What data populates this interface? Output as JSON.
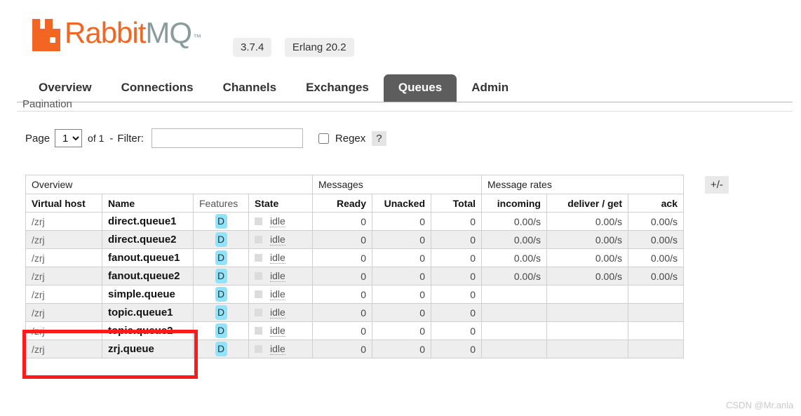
{
  "header": {
    "logo_rabbit": "Rabbit",
    "logo_mq": "MQ",
    "logo_tm": "™",
    "version": "3.7.4",
    "erlang_version": "Erlang 20.2"
  },
  "nav": {
    "tabs": [
      {
        "label": "Overview",
        "active": false
      },
      {
        "label": "Connections",
        "active": false
      },
      {
        "label": "Channels",
        "active": false
      },
      {
        "label": "Exchanges",
        "active": false
      },
      {
        "label": "Queues",
        "active": true
      },
      {
        "label": "Admin",
        "active": false
      }
    ]
  },
  "pagination": {
    "heading": "Pagination",
    "page_label": "Page",
    "page_value": "1",
    "page_options": [
      "1"
    ],
    "of_text": "of 1",
    "dash": "-",
    "filter_label": "Filter:",
    "filter_value": "",
    "filter_placeholder": "",
    "regex_label": "Regex",
    "regex_checked": false,
    "help_label": "?"
  },
  "table": {
    "toggle_label": "+/-",
    "group_headers": [
      {
        "label": "Overview",
        "span": 4
      },
      {
        "label": "Messages",
        "span": 3
      },
      {
        "label": "Message rates",
        "span": 3
      }
    ],
    "columns": [
      {
        "label": "Virtual host",
        "align": "left",
        "soft": false
      },
      {
        "label": "Name",
        "align": "left",
        "soft": false
      },
      {
        "label": "Features",
        "align": "left",
        "soft": true
      },
      {
        "label": "State",
        "align": "left",
        "soft": false
      },
      {
        "label": "Ready",
        "align": "right",
        "soft": false
      },
      {
        "label": "Unacked",
        "align": "right",
        "soft": false
      },
      {
        "label": "Total",
        "align": "right",
        "soft": false
      },
      {
        "label": "incoming",
        "align": "right",
        "soft": false
      },
      {
        "label": "deliver / get",
        "align": "right",
        "soft": false
      },
      {
        "label": "ack",
        "align": "right",
        "soft": false
      }
    ],
    "rows": [
      {
        "vhost": "/zrj",
        "name": "direct.queue1",
        "feature": "D",
        "state": "idle",
        "ready": "0",
        "unacked": "0",
        "total": "0",
        "incoming": "0.00/s",
        "deliver_get": "0.00/s",
        "ack": "0.00/s"
      },
      {
        "vhost": "/zrj",
        "name": "direct.queue2",
        "feature": "D",
        "state": "idle",
        "ready": "0",
        "unacked": "0",
        "total": "0",
        "incoming": "0.00/s",
        "deliver_get": "0.00/s",
        "ack": "0.00/s"
      },
      {
        "vhost": "/zrj",
        "name": "fanout.queue1",
        "feature": "D",
        "state": "idle",
        "ready": "0",
        "unacked": "0",
        "total": "0",
        "incoming": "0.00/s",
        "deliver_get": "0.00/s",
        "ack": "0.00/s"
      },
      {
        "vhost": "/zrj",
        "name": "fanout.queue2",
        "feature": "D",
        "state": "idle",
        "ready": "0",
        "unacked": "0",
        "total": "0",
        "incoming": "0.00/s",
        "deliver_get": "0.00/s",
        "ack": "0.00/s"
      },
      {
        "vhost": "/zrj",
        "name": "simple.queue",
        "feature": "D",
        "state": "idle",
        "ready": "0",
        "unacked": "0",
        "total": "0",
        "incoming": "",
        "deliver_get": "",
        "ack": ""
      },
      {
        "vhost": "/zrj",
        "name": "topic.queue1",
        "feature": "D",
        "state": "idle",
        "ready": "0",
        "unacked": "0",
        "total": "0",
        "incoming": "",
        "deliver_get": "",
        "ack": ""
      },
      {
        "vhost": "/zrj",
        "name": "topic.queue2",
        "feature": "D",
        "state": "idle",
        "ready": "0",
        "unacked": "0",
        "total": "0",
        "incoming": "",
        "deliver_get": "",
        "ack": ""
      },
      {
        "vhost": "/zrj",
        "name": "zrj.queue",
        "feature": "D",
        "state": "idle",
        "ready": "0",
        "unacked": "0",
        "total": "0",
        "incoming": "",
        "deliver_get": "",
        "ack": ""
      }
    ]
  },
  "annotation": {
    "color": "#fb1b1b"
  },
  "watermark": {
    "text": "CSDN @Mr.anla"
  }
}
